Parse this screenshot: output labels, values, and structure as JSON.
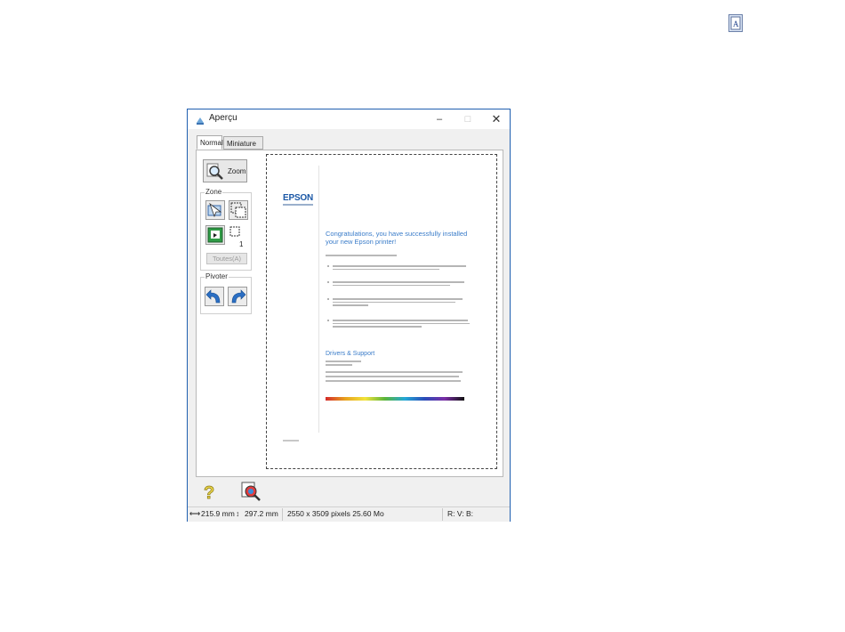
{
  "window": {
    "title": "Aperçu",
    "controls": {
      "minimize": "–",
      "maximize": "□",
      "close": "✕"
    }
  },
  "tabs": [
    {
      "label": "Normal",
      "selected": true
    },
    {
      "label": "Miniature",
      "selected": false
    }
  ],
  "sidebar": {
    "zoom_label": "Zoom",
    "zone_label": "Zone",
    "marquee_count": "1",
    "toutes_label": "Toutes(A)",
    "pivot_label": "Pivoter"
  },
  "preview": {
    "brand": "EPSON",
    "headline": "Congratulations, you have successfully installed your new Epson printer!",
    "drivers_heading": "Drivers & Support"
  },
  "statusbar": {
    "width": "215.9 mm",
    "height": "297.2 mm",
    "pixels": "2550 x 3509 pixels 25.60 Mo",
    "rgb": "R: V: B:"
  },
  "colors": {
    "window_border": "#1f5fb0",
    "headline": "#3a7cc9",
    "epson_blue": "#1b58a6"
  },
  "icons": [
    "scanner-document-icon",
    "app-icon",
    "zoom-magnifier-icon",
    "select-area-icon",
    "duplicate-marquee-icon",
    "auto-locate-icon",
    "marquee-icon",
    "rotate-left-icon",
    "rotate-right-icon",
    "help-icon",
    "preview-settings-icon"
  ]
}
